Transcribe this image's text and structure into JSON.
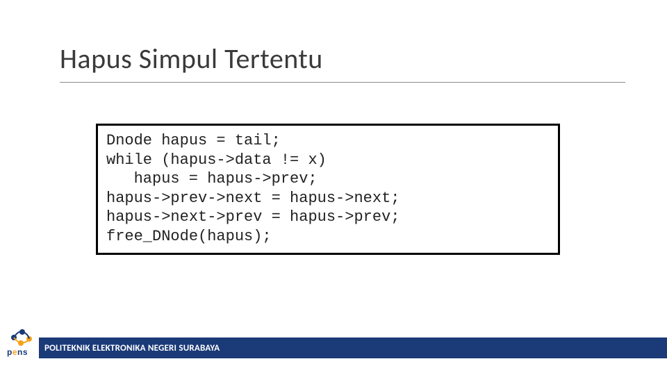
{
  "title": "Hapus Simpul Tertentu",
  "code": {
    "l1": "Dnode hapus = tail;",
    "l2": "while (hapus->data != x)",
    "l3": "hapus = hapus->prev;",
    "l4": "hapus->prev->next = hapus->next;",
    "l5": "hapus->next->prev = hapus->prev;",
    "l6": "free_DNode(hapus);"
  },
  "footer": "POLITEKNIK ELEKTRONIKA NEGERI SURABAYA",
  "logo": {
    "p": "p",
    "e": "e",
    "ns": "ns"
  }
}
